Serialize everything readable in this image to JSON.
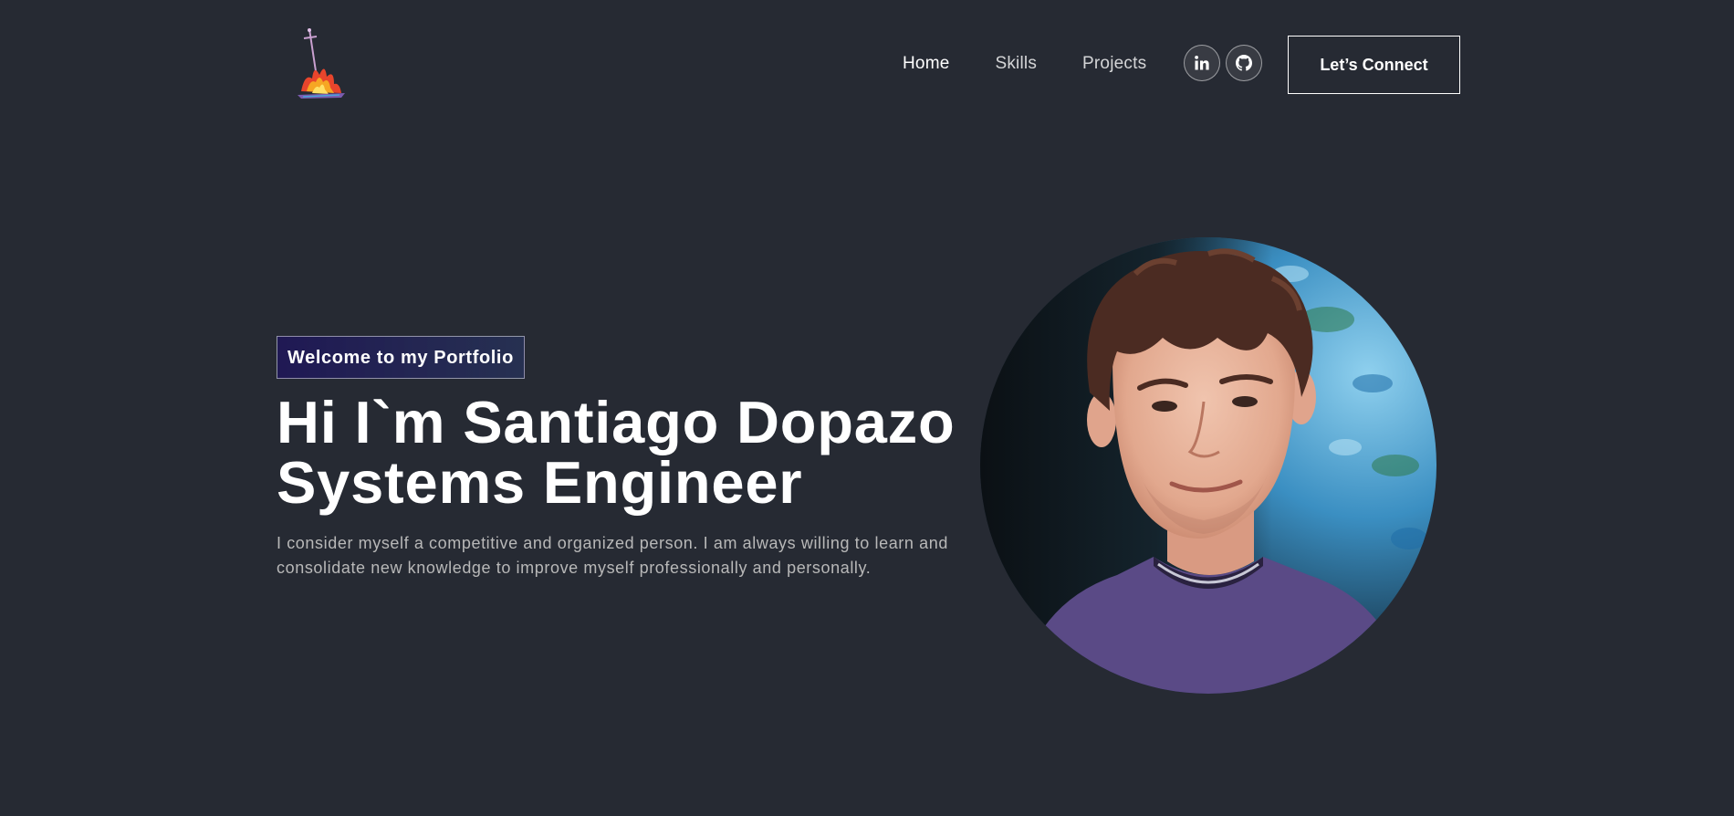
{
  "nav": {
    "links": [
      {
        "label": "Home"
      },
      {
        "label": "Skills"
      },
      {
        "label": "Projects"
      }
    ],
    "social": [
      {
        "icon": "linkedin-icon"
      },
      {
        "icon": "github-icon"
      }
    ],
    "connect_label": "Let’s Connect"
  },
  "hero": {
    "tagline": "Welcome to my Portfolio",
    "title_line1": "Hi I`m Santiago Dopazo",
    "title_line2": "Systems Engineer",
    "description": "I consider myself a competitive and organized person. I am always willing to learn and consolidate new knowledge to improve myself professionally and personally."
  },
  "colors": {
    "background": "#262a33",
    "text": "#ffffff",
    "muted_text": "#b8b8b8"
  }
}
